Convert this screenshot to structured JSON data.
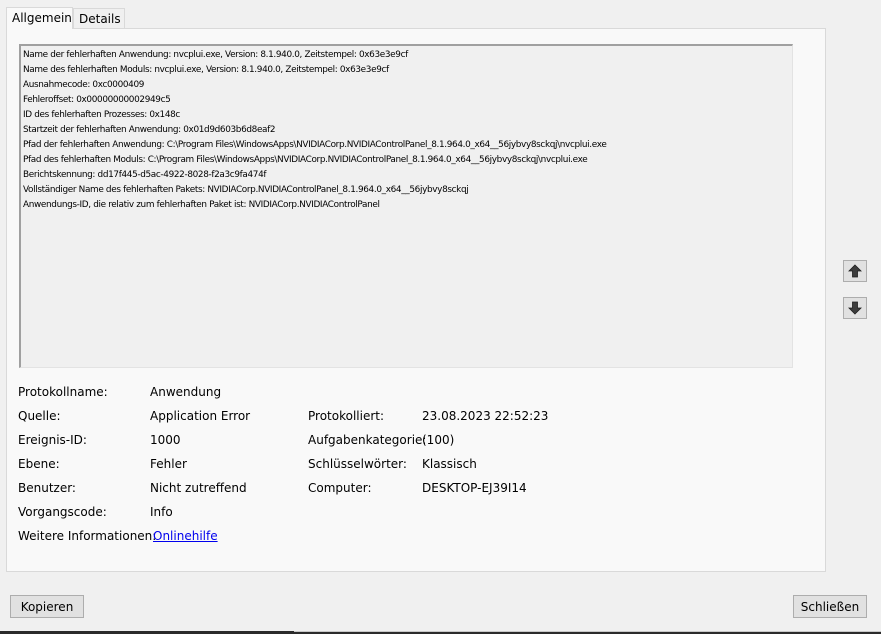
{
  "tabs": [
    {
      "label": "Allgemein",
      "active": true
    },
    {
      "label": "Details",
      "active": false
    }
  ],
  "description_lines": [
    "Name der fehlerhaften Anwendung: nvcplui.exe, Version: 8.1.940.0, Zeitstempel: 0x63e3e9cf",
    "Name des fehlerhaften Moduls: nvcplui.exe, Version: 8.1.940.0, Zeitstempel: 0x63e3e9cf",
    "Ausnahmecode: 0xc0000409",
    "Fehleroffset: 0x00000000002949c5",
    "ID des fehlerhaften Prozesses: 0x148c",
    "Startzeit der fehlerhaften Anwendung: 0x01d9d603b6d8eaf2",
    "Pfad der fehlerhaften Anwendung: C:\\Program Files\\WindowsApps\\NVIDIACorp.NVIDIAControlPanel_8.1.964.0_x64__56jybvy8sckqj\\nvcplui.exe",
    "Pfad des fehlerhaften Moduls: C:\\Program Files\\WindowsApps\\NVIDIACorp.NVIDIAControlPanel_8.1.964.0_x64__56jybvy8sckqj\\nvcplui.exe",
    "Berichtskennung: dd17f445-d5ac-4922-8028-f2a3c9fa474f",
    "Vollständiger Name des fehlerhaften Pakets: NVIDIACorp.NVIDIAControlPanel_8.1.964.0_x64__56jybvy8sckqj",
    "Anwendungs-ID, die relativ zum fehlerhaften Paket ist: NVIDIACorp.NVIDIAControlPanel"
  ],
  "fields": {
    "log_name": {
      "label": "Protokollname:",
      "value": "Anwendung"
    },
    "source": {
      "label": "Quelle:",
      "value": "Application Error"
    },
    "logged": {
      "label": "Protokolliert:",
      "value": "23.08.2023 22:52:23"
    },
    "event_id": {
      "label": "Ereignis-ID:",
      "value": "1000"
    },
    "task_category": {
      "label": "Aufgabenkategorie:",
      "value": "(100)"
    },
    "level": {
      "label": "Ebene:",
      "value": "Fehler"
    },
    "keywords": {
      "label": "Schlüsselwörter:",
      "value": "Klassisch"
    },
    "user": {
      "label": "Benutzer:",
      "value": "Nicht zutreffend"
    },
    "computer": {
      "label": "Computer:",
      "value": "DESKTOP-EJ39I14"
    },
    "opcode": {
      "label": "Vorgangscode:",
      "value": "Info"
    },
    "more_info": {
      "label": "Weitere Informationen:",
      "link": "Onlinehilfe"
    }
  },
  "buttons": {
    "copy": "Kopieren",
    "close": "Schließen"
  },
  "icons": {
    "up": "arrow-up-icon",
    "down": "arrow-down-icon"
  }
}
